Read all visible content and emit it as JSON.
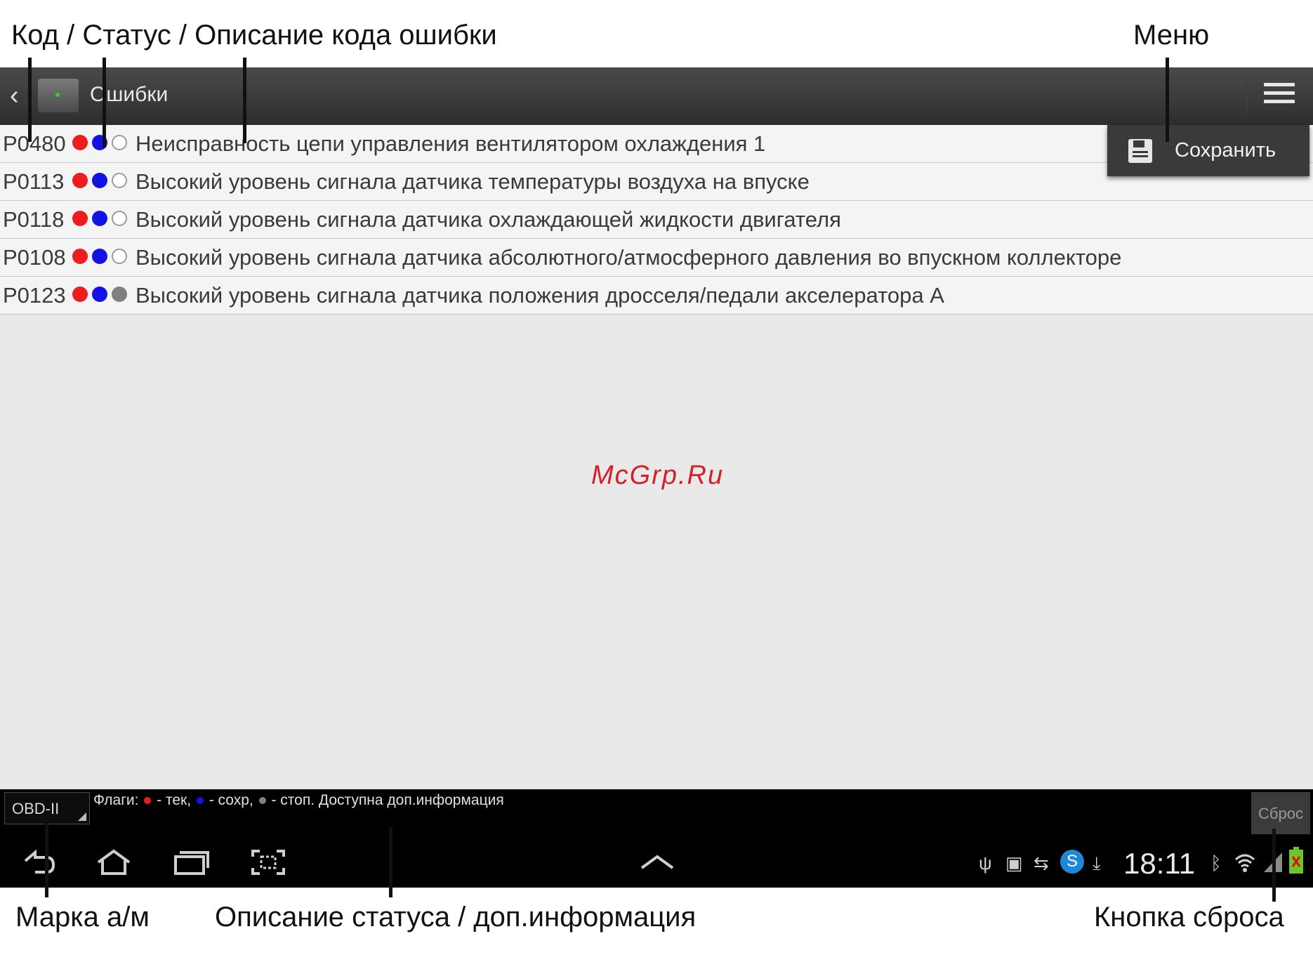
{
  "annotations": {
    "top_left": "Код / Статус / Описание кода ошибки",
    "top_right": "Меню",
    "bottom_left": "Марка а/м",
    "bottom_middle": "Описание статуса / доп.информация",
    "bottom_right": "Кнопка сброса"
  },
  "header": {
    "title": "Ошибки",
    "back_icon": "chevron-left-icon",
    "app_icon": "obd-adapter-icon",
    "menu_icon": "overflow-menu-icon"
  },
  "menu": {
    "save_label": "Сохранить",
    "save_icon": "floppy-disk-icon"
  },
  "errors": [
    {
      "code": "P0480",
      "current": true,
      "stored": true,
      "stop": false,
      "description": "Неисправность цепи управления вентилятором охлаждения 1"
    },
    {
      "code": "P0113",
      "current": true,
      "stored": true,
      "stop": false,
      "description": "Высокий уровень сигнала датчика температуры воздуха на впуске"
    },
    {
      "code": "P0118",
      "current": true,
      "stored": true,
      "stop": false,
      "description": "Высокий уровень сигнала датчика охлаждающей жидкости двигателя"
    },
    {
      "code": "P0108",
      "current": true,
      "stored": true,
      "stop": false,
      "description": "Высокий уровень сигнала датчика абсолютного/атмосферного давления во впускном коллекторе"
    },
    {
      "code": "P0123",
      "current": true,
      "stored": true,
      "stop": true,
      "description": "Высокий уровень сигнала датчика положения дросселя/педали акселератора A"
    }
  ],
  "colors": {
    "current": "#ee1c1c",
    "stored": "#1212e6",
    "stop": "#808080",
    "watermark": "#d42027"
  },
  "watermark": "McGrp.Ru",
  "status_bar": {
    "make_select": "OBD-II",
    "flags_prefix": "Флаги:",
    "flag_current": "- тек,",
    "flag_stored": "- сохр,",
    "flag_stop": "- стоп.",
    "extra_info": "Доступна доп.информация",
    "reset_label": "Сброс"
  },
  "system_bar": {
    "clock": "18:11",
    "nav_icons": [
      "back-icon",
      "home-icon",
      "recent-apps-icon",
      "screenshot-icon",
      "up-chevron-icon"
    ],
    "status_icons": [
      "usb-icon",
      "sd-card-icon",
      "sync-icon",
      "skype-icon",
      "download-icon",
      "bluetooth-icon",
      "wifi-icon",
      "signal-icon",
      "battery-icon"
    ]
  }
}
